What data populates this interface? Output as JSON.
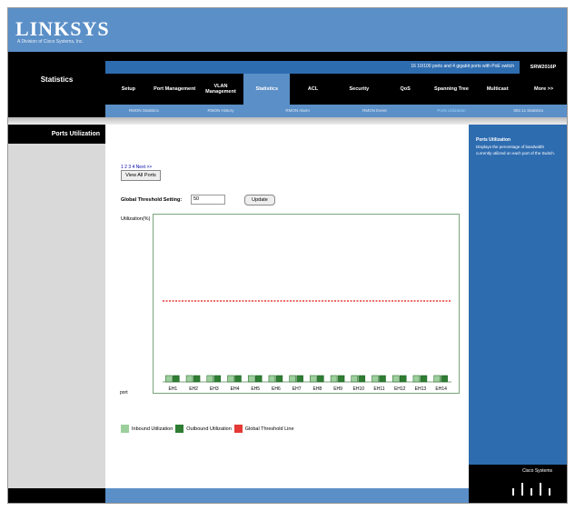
{
  "brand": {
    "logo": "LINKSYS",
    "subtitle": "A Division of Cisco Systems, Inc."
  },
  "header": {
    "section_title": "Statistics",
    "info": "16 10/100 ports and 4 gigabit ports with PoE switch",
    "model": "SRW2016P"
  },
  "tabs": [
    "Setup",
    "Port Management",
    "VLAN Management",
    "Statistics",
    "ACL",
    "Security",
    "QoS",
    "Spanning Tree",
    "Multicast",
    "More >>"
  ],
  "active_tab": "Statistics",
  "subtabs": [
    "RMON Statistics",
    "RMON History",
    "RMON Alarm",
    "RMON Event",
    "Ports Utilization",
    "802.1x Statistics"
  ],
  "active_subtab": "Ports Utilization",
  "leftnav": {
    "item": "Ports Utilization"
  },
  "page": {
    "page_links": "1 2 3 4 Next >>",
    "view_all": "View All Ports",
    "threshold_label": "Global Threshold Setting:",
    "threshold_value": "50",
    "update": "Update",
    "util_label": "Utilization(%)",
    "port_label": "port"
  },
  "chart_data": {
    "type": "bar",
    "title": "",
    "xlabel": "port",
    "ylabel": "Utilization(%)",
    "ylim": [
      0,
      100
    ],
    "categories": [
      "EH1",
      "EH2",
      "EH3",
      "EH4",
      "EH5",
      "EH6",
      "EH7",
      "EH8",
      "EH9",
      "EH10",
      "EH11",
      "EH12",
      "EH13",
      "EH14"
    ],
    "series": [
      {
        "name": "Inbound Utilization",
        "color": "#9ccf9c",
        "values": [
          0,
          0,
          0,
          0,
          0,
          0,
          0,
          0,
          0,
          0,
          0,
          0,
          0,
          0
        ]
      },
      {
        "name": "Outbound Utilization",
        "color": "#2e7d32",
        "values": [
          0,
          0,
          0,
          0,
          0,
          0,
          0,
          0,
          0,
          0,
          0,
          0,
          0,
          0
        ]
      }
    ],
    "threshold": {
      "name": "Global Threshold Line",
      "value": 50,
      "color": "#e53935"
    },
    "legend": "bottom-left",
    "grid": false
  },
  "help": {
    "title": "Ports Utilization",
    "text": "Displays the percentage of bandwidth currently utilized on each port of the Switch."
  },
  "footer": {
    "brand": "Cisco Systems"
  },
  "colors": {
    "header_blue": "#5b8fc7",
    "panel_blue": "#2e6cb0",
    "inbound": "#9ccf9c",
    "outbound": "#2e7d32",
    "threshold": "#e53935"
  }
}
